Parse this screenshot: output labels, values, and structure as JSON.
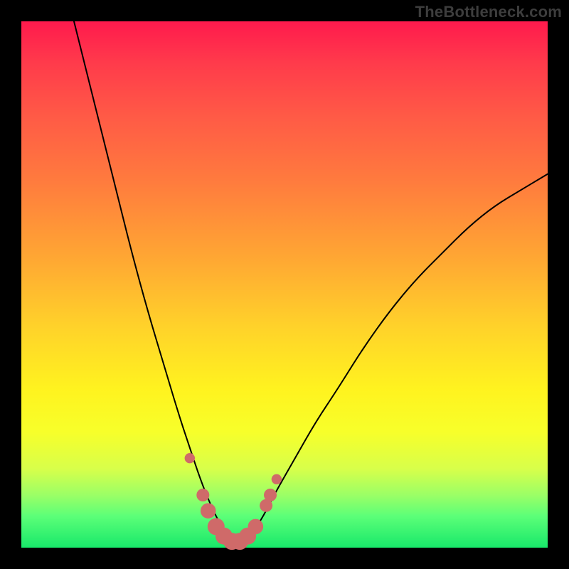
{
  "watermark": "TheBottleneck.com",
  "colors": {
    "frame": "#000000",
    "curve": "#000000",
    "marker": "#cf6a69",
    "gradient_top": "#ff1a4d",
    "gradient_bottom": "#18e86a"
  },
  "chart_data": {
    "type": "line",
    "title": "",
    "xlabel": "",
    "ylabel": "",
    "xlim": [
      0,
      100
    ],
    "ylim": [
      0,
      100
    ],
    "curve": {
      "description": "Bottleneck curve. y = 0 is optimal (bottom of plot, green). Higher y = worse (top, red). Minimum around x ≈ 39–42.",
      "x": [
        10,
        12,
        15,
        18,
        21,
        24,
        27,
        30,
        32,
        34,
        36,
        38,
        40,
        42,
        44,
        46,
        48,
        52,
        56,
        60,
        65,
        70,
        75,
        80,
        85,
        90,
        95,
        100
      ],
      "y": [
        100,
        92,
        80,
        68,
        56,
        45,
        35,
        25,
        19,
        13,
        8,
        4,
        1,
        1,
        3,
        6,
        10,
        17,
        24,
        30,
        38,
        45,
        51,
        56,
        61,
        65,
        68,
        71
      ]
    },
    "markers": {
      "description": "Highlighted near-optimal points shown as salmon dots near the curve minimum.",
      "points": [
        {
          "x": 32.0,
          "y": 17.0,
          "r": 1.2
        },
        {
          "x": 34.5,
          "y": 10.0,
          "r": 1.5
        },
        {
          "x": 35.5,
          "y": 7.0,
          "r": 1.8
        },
        {
          "x": 37.0,
          "y": 4.0,
          "r": 2.0
        },
        {
          "x": 38.5,
          "y": 2.2,
          "r": 2.0
        },
        {
          "x": 40.0,
          "y": 1.2,
          "r": 2.0
        },
        {
          "x": 41.5,
          "y": 1.2,
          "r": 2.0
        },
        {
          "x": 43.0,
          "y": 2.2,
          "r": 2.0
        },
        {
          "x": 44.5,
          "y": 4.0,
          "r": 1.8
        },
        {
          "x": 46.5,
          "y": 8.0,
          "r": 1.5
        },
        {
          "x": 47.3,
          "y": 10.0,
          "r": 1.5
        },
        {
          "x": 48.5,
          "y": 13.0,
          "r": 1.2
        }
      ]
    }
  }
}
